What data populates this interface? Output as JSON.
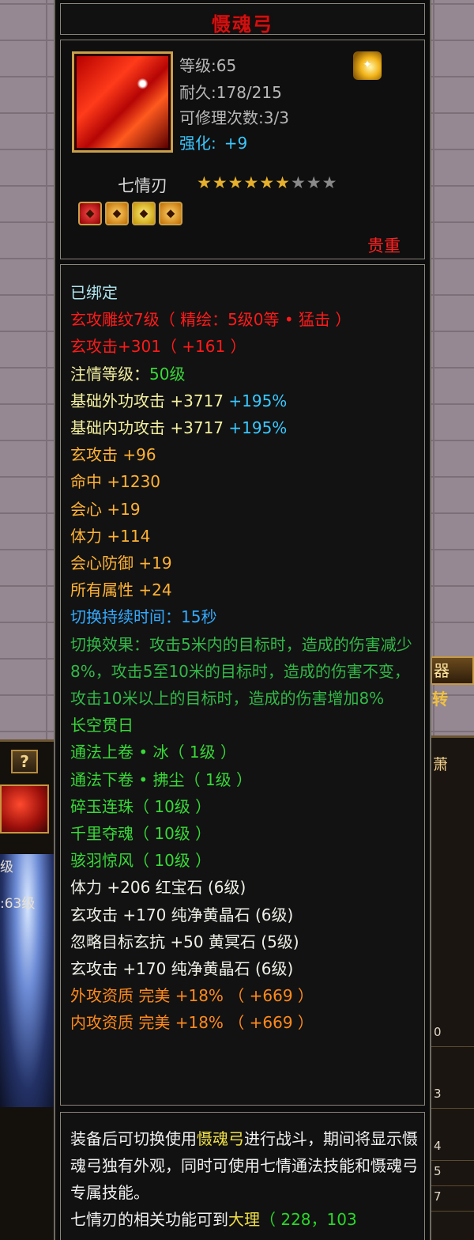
{
  "background": {
    "left_help_glyph": "?",
    "left_texts": [
      "级",
      ":63级"
    ],
    "right_tab_text": "器",
    "right_tab_sub": "转",
    "right_tab_name": "萧",
    "right_rows": [
      "0",
      "3",
      "4",
      "5",
      "7"
    ]
  },
  "item": {
    "name": "慑魂弓",
    "level_label": "等级",
    "level": "65",
    "durability_label": "耐久",
    "durability": "178/215",
    "repair_label": "可修理次数",
    "repair_count": "3/3",
    "enhance_label": "强化:",
    "enhance_value": "+9",
    "set_name": "七情刃",
    "stars_filled": 6,
    "stars_total": 9,
    "gem_slots": [
      "red",
      "amber",
      "gold",
      "amber"
    ],
    "rarity": "贵重"
  },
  "attributes": {
    "bound": "已绑定",
    "carve": "玄攻雕纹7级（ 精绘：5级0等 • 猛击 ）",
    "xuan_attack": "玄攻击+301（ +161 ）",
    "infuse_label": "注情等级：",
    "infuse_value": "50级",
    "base_ext_label": "基础外功攻击  +3717",
    "base_ext_pct": "+195%",
    "base_int_label": "基础内功攻击  +3717",
    "base_int_pct": "+195%",
    "stats": [
      "玄攻击  +96",
      "命中  +1230",
      "会心  +19",
      "体力  +114",
      "会心防御  +19",
      "所有属性  +24"
    ],
    "switch_duration": "切换持续时间：15秒",
    "switch_effect": "切换效果：攻击5米内的目标时，造成的伤害减少8%，攻击5至10米的目标时，造成的伤害不变，攻击10米以上的目标时，造成的伤害增加8%",
    "skills": [
      "长空贯日",
      "通法上卷 • 冰（ 1级 ）",
      "通法下卷 • 拂尘（ 1级 ）",
      "碎玉连珠（ 10级 ）",
      "千里夺魂（ 10级 ）",
      "骇羽惊风（ 10级 ）"
    ],
    "gems": [
      "体力  +206  红宝石 (6级)",
      "玄攻击  +170  纯净黄晶石 (6级)",
      "忽略目标玄抗  +50  黄冥石 (5级)",
      "玄攻击  +170  纯净黄晶石 (6级)"
    ],
    "qualities": [
      "外攻资质    完美  +18% （ +669 ）",
      "内攻资质    完美  +18% （ +669 ）"
    ]
  },
  "description": {
    "p1_a": "装备后可切换使用",
    "p1_hl": "慑魂弓",
    "p1_b": "进行战斗，期间将显示慑魂弓独有外观，同时可使用七情通法技能和慑魂弓专属技能。",
    "p2_a": "七情刃的相关功能可到",
    "p2_hl": "大理",
    "p2_coord": "（ 228，103"
  },
  "colors": {
    "title": "#d01010",
    "rarity": "#ff2020",
    "enhance": "#39c8ff",
    "skill": "#38d838",
    "quality": "#ff8a1c"
  },
  "icons": {
    "item": "bow-icon",
    "special": "gold-sparkle-icon",
    "star": "star-icon"
  }
}
